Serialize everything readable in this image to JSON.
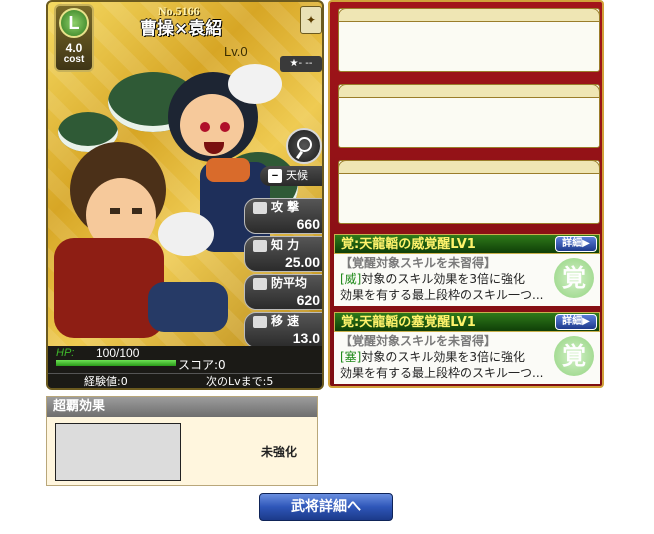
{
  "card": {
    "number": "No.5166",
    "name": "曹操×袁紹",
    "level": "Lv.0",
    "rank_letter": "L",
    "cost_value": "4.0",
    "cost_label": "cost",
    "rarity": "★- --",
    "weather": "天候",
    "stats": {
      "attack_label": "攻 撃",
      "attack_value": "660",
      "intelligence_label": "知 力",
      "intelligence_value": "25.00",
      "defense_label": "防平均",
      "defense_value": "620",
      "speed_label": "移 速",
      "speed_value": "13.0"
    },
    "hp_label": "HP:",
    "hp_value": "100/100",
    "hp_fraction": 1.0,
    "score": "スコア:0",
    "exp": "経験値:0",
    "next_level": "次のLvまで:5"
  },
  "awakenings": [
    {
      "title": "覚:天龍韜の威覚醒LV1",
      "detail_button": "詳細▶",
      "status": "【覚醒対象スキルを未習得】",
      "tag": "[威]",
      "line1": "対象のスキル効果を3倍に強化",
      "line2": "効果を有する最上段枠のスキル一つ...",
      "kanji": "覚"
    },
    {
      "title": "覚:天龍韜の塞覚醒LV1",
      "detail_button": "詳細▶",
      "status": "【覚醒対象スキルを未習得】",
      "tag": "[塞]",
      "line1": "対象のスキル効果を3倍に強化",
      "line2": "効果を有する最上段枠のスキル一つ...",
      "kanji": "覚"
    }
  ],
  "choha": {
    "header": "超覇効果",
    "status": "未強化"
  },
  "detail_button": "武将詳細へ"
}
